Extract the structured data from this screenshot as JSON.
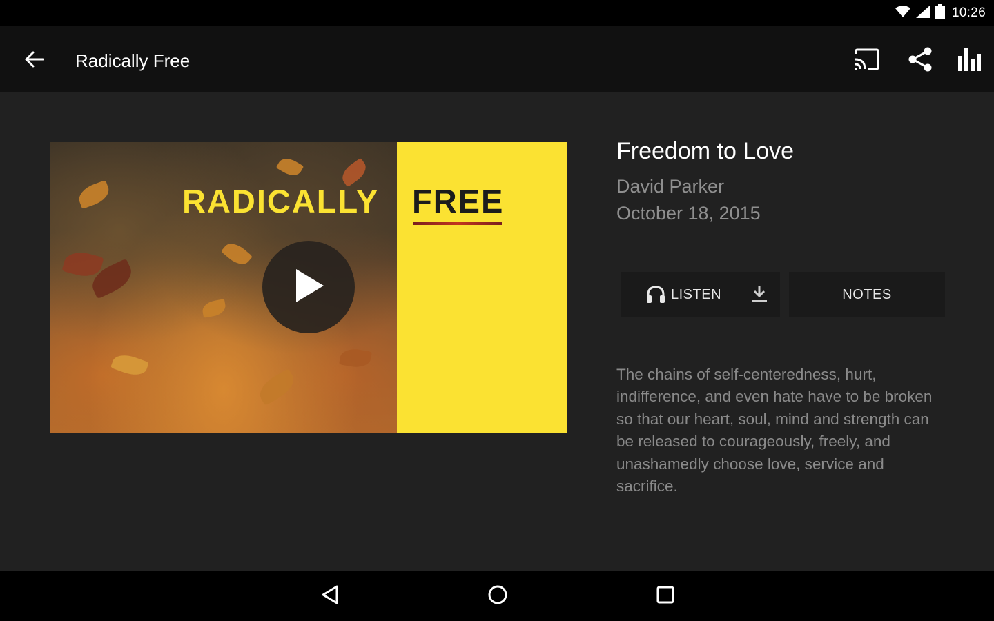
{
  "status_bar": {
    "time": "10:26",
    "icons": [
      "wifi-icon",
      "cell-signal-icon",
      "battery-icon"
    ]
  },
  "toolbar": {
    "title": "Radically Free",
    "icons": [
      "back-arrow-icon",
      "cast-icon",
      "share-icon",
      "bar-chart-icon"
    ]
  },
  "artwork": {
    "word1": "RADICALLY",
    "word2": "FREE",
    "accent_color": "#fbe232"
  },
  "sermon": {
    "title": "Freedom to Love",
    "speaker": "David Parker",
    "date": "October 18, 2015",
    "description": "The chains of self-centeredness, hurt, indifference, and even hate have to be broken so that our heart, soul, mind and strength can be released to courageously, freely, and unashamedly choose love, service and sacrifice."
  },
  "actions": {
    "listen_label": "LISTEN",
    "notes_label": "NOTES"
  },
  "nav_bar": {
    "icons": [
      "back-triangle-icon",
      "home-circle-icon",
      "recents-square-icon"
    ]
  }
}
